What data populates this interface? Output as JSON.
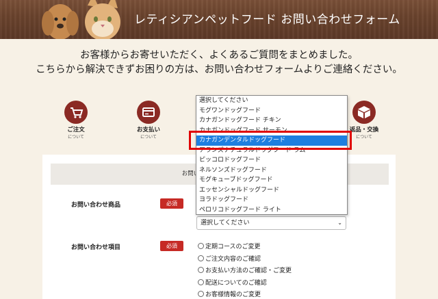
{
  "header": {
    "title": "レティシアンペットフード お問い合わせフォーム"
  },
  "intro": {
    "line1": "お客様からお寄せいただく、よくあるご質問をまとめました。",
    "line2": "こちらから解決できずお困りの方は、お問い合わせフォームよりご連絡ください。"
  },
  "categories": [
    {
      "label": "ご注文",
      "sub": "について",
      "icon": "cart-icon"
    },
    {
      "label": "お支払い",
      "sub": "について",
      "icon": "card-icon"
    },
    {
      "label": "返品・交換",
      "sub": "について",
      "icon": "box-icon"
    }
  ],
  "dropdown": {
    "options": [
      "選択してください",
      "モグワンドッグフード",
      "カナガンドッグフード チキン",
      "カナガンドッグフード サーモン",
      "カナガンデンタルドッグフード",
      "アランズナチュラルドッグフード ラム",
      "ピッコロドッグフード",
      "ネルソンズドッグフード",
      "モグキューブドッグフード",
      "エッセンシャルドッグフード",
      "ヨラドッグフード",
      "ペロリコドッグフード ライト"
    ],
    "selected_index": 4
  },
  "form": {
    "notice": "お問い合わせ内容を入力後、",
    "product_label": "お問い合わせ商品",
    "item_label": "お問い合わせ項目",
    "required": "必須",
    "select_value": "選択してください",
    "radios": [
      "定期コースのご変更",
      "ご注文内容のご確認",
      "お支払い方法のご確認・ご変更",
      "配送についてのご確認",
      "お客様情報のご変更"
    ]
  },
  "colors": {
    "accent": "#8b2a24",
    "required": "#c62a25",
    "highlight": "#e00000",
    "selected": "#1e7fe0"
  }
}
